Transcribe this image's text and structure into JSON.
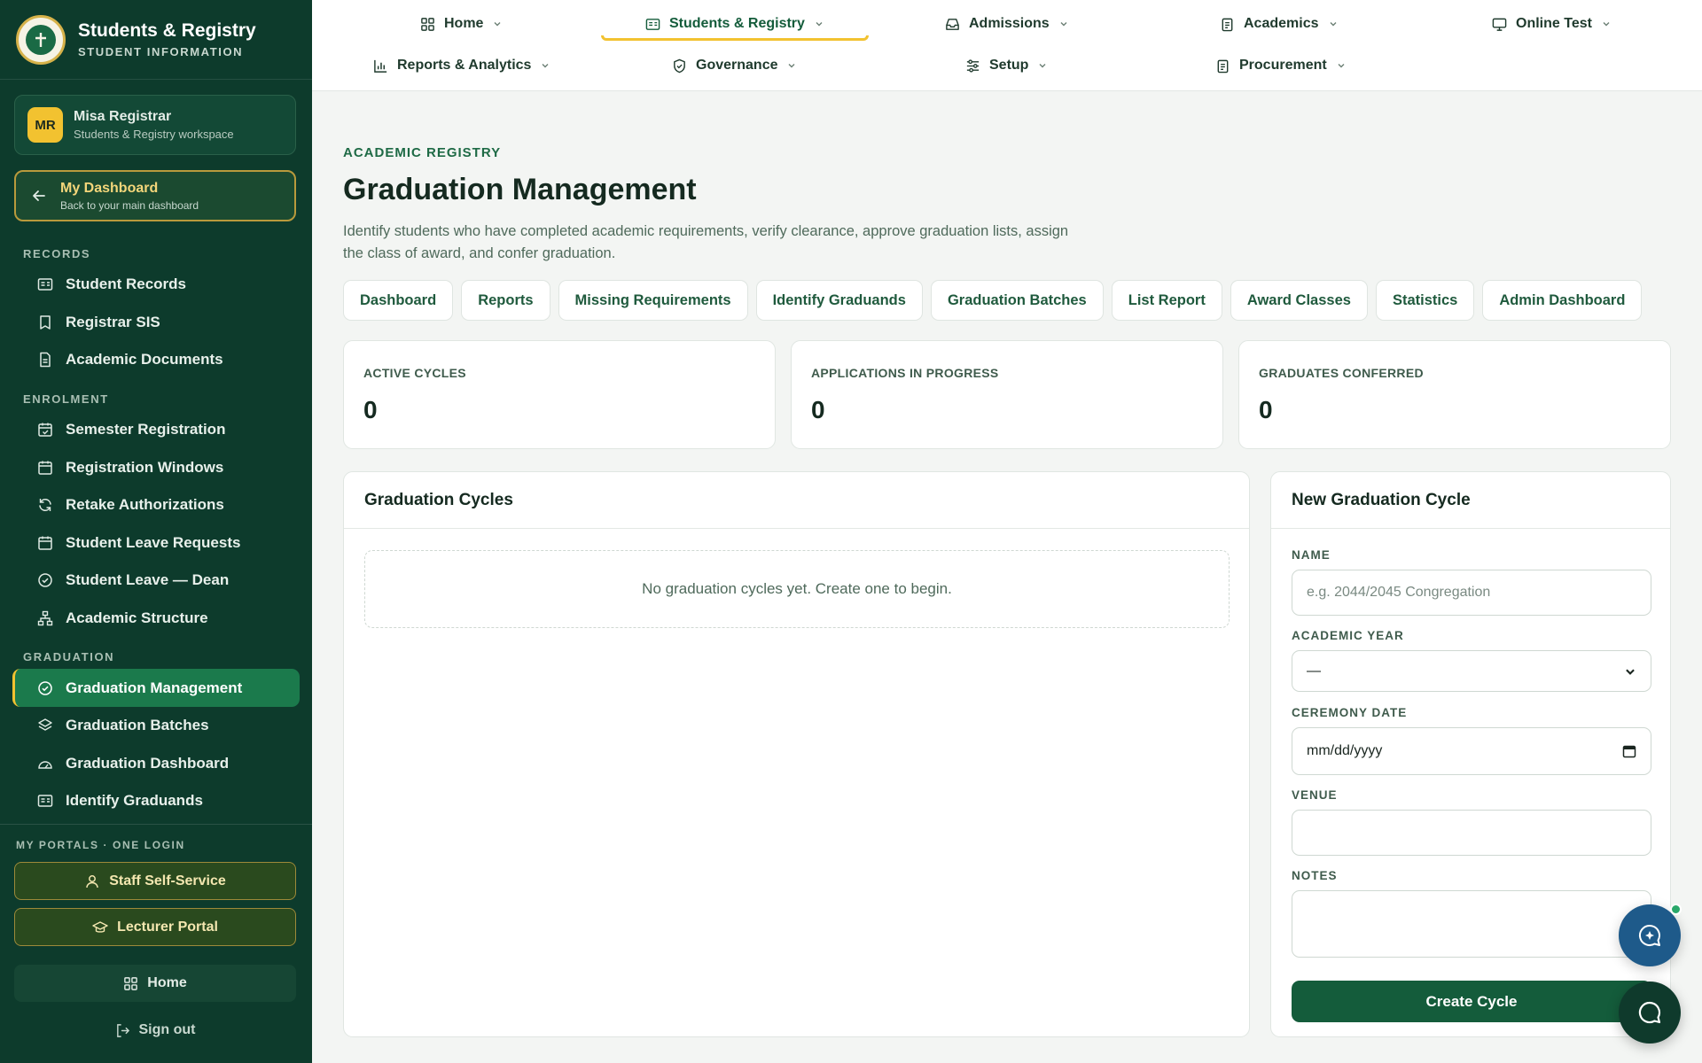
{
  "brand": {
    "title": "Students & Registry",
    "subtitle": "STUDENT INFORMATION"
  },
  "user": {
    "initials": "MR",
    "name": "Misa Registrar",
    "workspace": "Students & Registry workspace"
  },
  "dashboard_link": {
    "title": "My Dashboard",
    "subtitle": "Back to your main dashboard"
  },
  "sidebar": {
    "sections": [
      {
        "label": "RECORDS",
        "items": [
          {
            "label": "Student Records",
            "icon": "id-card-icon"
          },
          {
            "label": "Registrar SIS",
            "icon": "bookmark-icon"
          },
          {
            "label": "Academic Documents",
            "icon": "document-icon"
          }
        ]
      },
      {
        "label": "ENROLMENT",
        "items": [
          {
            "label": "Semester Registration",
            "icon": "calendar-check-icon"
          },
          {
            "label": "Registration Windows",
            "icon": "calendar-icon"
          },
          {
            "label": "Retake Authorizations",
            "icon": "refresh-icon"
          },
          {
            "label": "Student Leave Requests",
            "icon": "calendar-icon"
          },
          {
            "label": "Student Leave — Dean",
            "icon": "check-circle-icon"
          },
          {
            "label": "Academic Structure",
            "icon": "hierarchy-icon"
          }
        ]
      },
      {
        "label": "GRADUATION",
        "items": [
          {
            "label": "Graduation Management",
            "icon": "check-circle-icon",
            "active": true
          },
          {
            "label": "Graduation Batches",
            "icon": "layers-icon"
          },
          {
            "label": "Graduation Dashboard",
            "icon": "gauge-icon"
          },
          {
            "label": "Identify Graduands",
            "icon": "id-card-icon"
          }
        ]
      }
    ]
  },
  "portals": {
    "label": "MY PORTALS · ONE LOGIN",
    "staff": "Staff Self-Service",
    "lecturer": "Lecturer Portal",
    "home": "Home",
    "signout": "Sign out"
  },
  "topnav": {
    "home": "Home",
    "students": "Students & Registry",
    "admissions": "Admissions",
    "academics": "Academics",
    "online_test": "Online Test",
    "reports": "Reports & Analytics",
    "governance": "Governance",
    "setup": "Setup",
    "procurement": "Procurement"
  },
  "page": {
    "eyebrow": "ACADEMIC REGISTRY",
    "title": "Graduation Management",
    "description": "Identify students who have completed academic requirements, verify clearance, approve graduation lists, assign the class of award, and confer graduation."
  },
  "tabs": [
    "Dashboard",
    "Reports",
    "Missing Requirements",
    "Identify Graduands",
    "Graduation Batches",
    "List Report",
    "Award Classes",
    "Statistics",
    "Admin Dashboard"
  ],
  "stats": {
    "active_cycles": {
      "label": "ACTIVE CYCLES",
      "value": "0"
    },
    "applications": {
      "label": "APPLICATIONS IN PROGRESS",
      "value": "0"
    },
    "conferred": {
      "label": "GRADUATES CONFERRED",
      "value": "0"
    }
  },
  "cycles_panel": {
    "title": "Graduation Cycles",
    "empty": "No graduation cycles yet. Create one to begin."
  },
  "form": {
    "title": "New Graduation Cycle",
    "name_label": "NAME",
    "name_placeholder": "e.g. 2044/2045 Congregation",
    "year_label": "ACADEMIC YEAR",
    "year_value": "—",
    "date_label": "CEREMONY DATE",
    "date_value": "mm/dd/yyyy",
    "venue_label": "VENUE",
    "notes_label": "NOTES",
    "submit": "Create Cycle"
  },
  "colors": {
    "sidebar": "#0d3b2c",
    "accent": "#145c3b",
    "highlight": "#f2c230"
  }
}
